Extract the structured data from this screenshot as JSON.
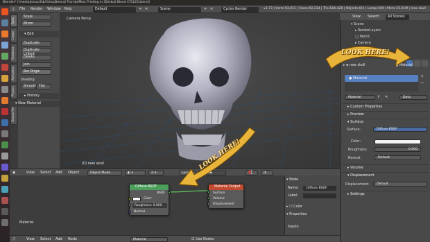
{
  "os_title": "Blender* [/media/jesus/4tb/3drspDmsnt/ Florida/Mtzs Printing in 3D/skull Blend CYCLES.blend]",
  "header": {
    "menus": [
      "File",
      "Render",
      "Window",
      "Help"
    ],
    "layout": "Default",
    "scene": "Scene",
    "engine": "Cycles Render",
    "stats": "v2.73 | Verts:93,011 | Faces:92,214 | Tris:184,428 | Objects:0/4 | Lamps:0/0 | Mem:15.41M | new skull"
  },
  "toolshelf": {
    "tabs": [
      "Tools",
      "Create",
      "Relations",
      "Animation",
      "Physics",
      "Grease Pencil"
    ],
    "top_buttons": [
      "Scale",
      "Mirror"
    ],
    "edit_panel": "Edit",
    "edit_buttons": [
      "Duplicate",
      "Duplicate Linked",
      "Delete",
      "Join"
    ],
    "set_origin": "Set Origin",
    "shading_label": "Shading:",
    "smooth_label": "Smooth",
    "flat_label": "Flat",
    "history_panel": "History",
    "operator_panel": "New Material"
  },
  "viewport": {
    "camera_label": "Camera Persp",
    "object_label": "(0) new skull"
  },
  "viewport_header": {
    "menus": [
      "View",
      "Select",
      "Add",
      "Object"
    ],
    "mode": "Object Mode",
    "layer_text": "Local"
  },
  "node_editor": {
    "material_label": "Material",
    "diffuse_node": {
      "title": "Diffuse BSDF",
      "output": "BSDF",
      "color_label": "Color",
      "roughness": "Roughness: 0.000",
      "normal": "Normal"
    },
    "output_node": {
      "title": "Material Output",
      "inputs": [
        "Surface",
        "Volume",
        "Displacement"
      ]
    },
    "sidebar": {
      "node_panel": "Node",
      "name_label": "Name:",
      "name_value": "Diffuse BSDF",
      "label_label": "Label:",
      "color_panel": "Color",
      "properties_panel": "Properties",
      "inputs_label": "Inputs:"
    }
  },
  "bottom_header": {
    "menus": [
      "View",
      "Select",
      "Add",
      "Node"
    ],
    "material": "Material",
    "use_nodes": "Use Nodes"
  },
  "outliner": {
    "menus": [
      "View",
      "Search"
    ],
    "scope": "All Scenes",
    "items": [
      "Scene",
      "RenderLayers",
      "World",
      "Camera"
    ]
  },
  "properties": {
    "breadcrumb_skull": "new skull",
    "breadcrumb_material": "Material",
    "slot": "Material",
    "material_name": "Material",
    "user_count": "F",
    "data_link": "Data",
    "sections": {
      "custom_props": "Custom Properties",
      "preview": "Preview",
      "surface": "Surface",
      "volume": "Volume",
      "displacement": "Displacement",
      "settings": "Settings"
    },
    "surface_label": "Surface:",
    "surface_value": "Diffuse BSDF",
    "color_label": "Color:",
    "roughness_label": "Roughness:",
    "roughness_value": "0.000",
    "normal_label": "Normal:",
    "normal_value": "Default",
    "displacement_label": "Displacement:",
    "displacement_value": "Default"
  },
  "overlay": {
    "look_here_1": "LOOK HERE!",
    "look_here_2": "LOOK HERE!"
  },
  "colors": {
    "accent_blue": "#5680c2",
    "node_shader": "#4c9e5a",
    "node_output": "#c24b2f",
    "socket_green": "#63c763",
    "socket_yellow": "#c7c729",
    "socket_purple": "#6363c7",
    "gold": "#e8b53a"
  }
}
